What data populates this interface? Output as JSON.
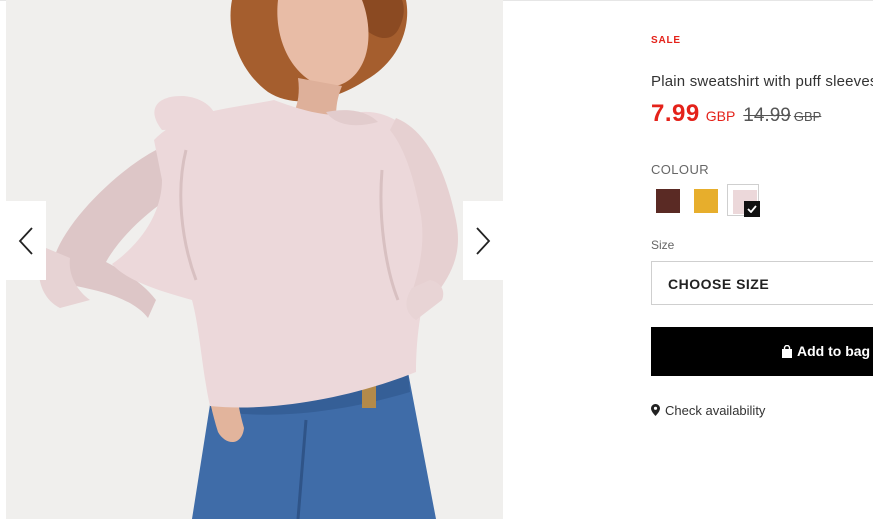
{
  "gallery": {
    "image_alt": "Woman wearing a light pink plain sweatshirt with puff sleeves and blue jeans",
    "prev_icon": "chevron-left-icon",
    "next_icon": "chevron-right-icon"
  },
  "product": {
    "badge": "SALE",
    "title": "Plain sweatshirt with puff sleeves",
    "price": {
      "current": "7.99",
      "currency": "GBP",
      "original": "14.99",
      "original_currency": "GBP"
    }
  },
  "colour": {
    "label": "COLOUR",
    "options": [
      {
        "name": "brown",
        "hex": "#5a2a24",
        "selected": false
      },
      {
        "name": "yellow",
        "hex": "#e7ae2c",
        "selected": false
      },
      {
        "name": "pink",
        "hex": "#ecd8da",
        "selected": true
      }
    ]
  },
  "size": {
    "label": "Size",
    "placeholder": "CHOOSE SIZE"
  },
  "actions": {
    "add_to_bag": "Add to bag",
    "add_to_bag_icon": "shopping-bag-icon",
    "check_availability": "Check availability",
    "location_icon": "location-pin-icon"
  },
  "colors": {
    "sale": "#e4221a",
    "button_bg": "#000000"
  }
}
